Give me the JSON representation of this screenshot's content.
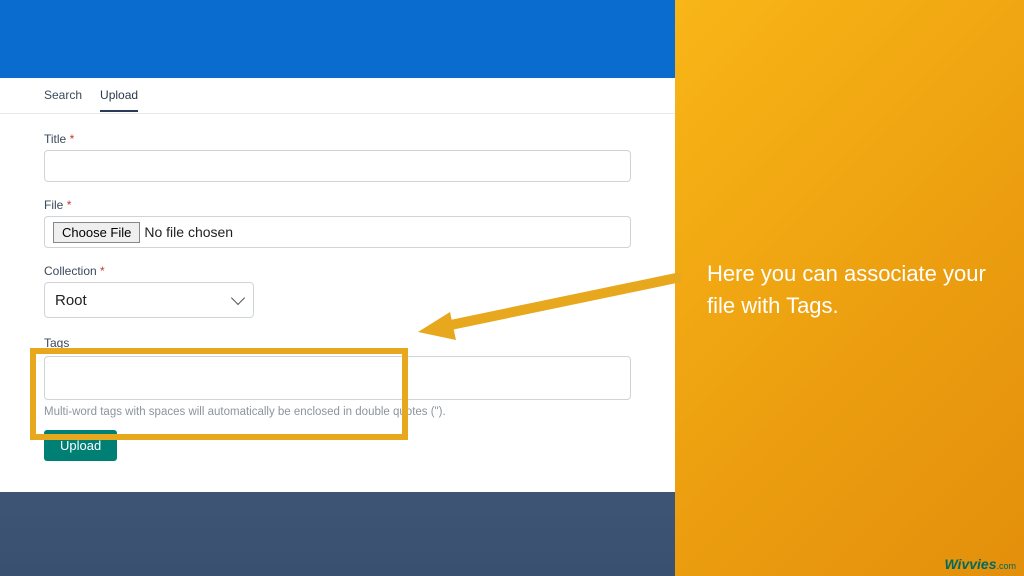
{
  "tabs": {
    "search": "Search",
    "upload": "Upload"
  },
  "form": {
    "title_label": "Title",
    "file_label": "File",
    "choose_button": "Choose File",
    "no_file_text": "No file chosen",
    "collection_label": "Collection",
    "collection_value": "Root",
    "tags_label": "Tags",
    "tags_hint": "Multi-word tags with spaces will automatically be enclosed in double quotes (\").",
    "upload_button": "Upload",
    "required_star": "*"
  },
  "annotation": {
    "text": "Here you can associate your file with Tags."
  },
  "brand": {
    "name": "Wivvies",
    "domain": ".com"
  }
}
